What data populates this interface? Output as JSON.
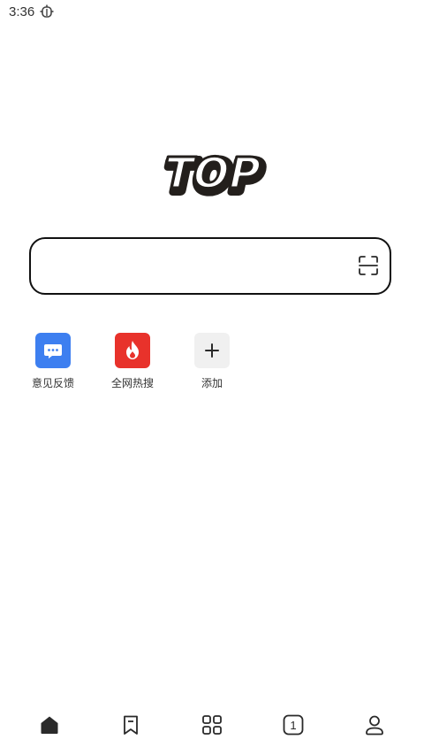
{
  "status_bar": {
    "time": "3:36",
    "notification_icon": "bug-icon"
  },
  "logo": {
    "text": "TOP",
    "colors": {
      "fill": "#ffffff",
      "outline": "#231f1c"
    }
  },
  "search": {
    "value": "",
    "placeholder": "",
    "scan_icon": "scan-icon"
  },
  "shortcuts": [
    {
      "label": "意见反馈",
      "icon": "chat-bubble-icon",
      "color": "#3d7ff0"
    },
    {
      "label": "全网热搜",
      "icon": "flame-icon",
      "color": "#e8322b"
    },
    {
      "label": "添加",
      "icon": "plus-icon",
      "color": "#f0f0f0"
    }
  ],
  "tab_bar": {
    "items": [
      {
        "icon": "home-icon",
        "active": true
      },
      {
        "icon": "bookmark-icon",
        "active": false
      },
      {
        "icon": "apps-grid-icon",
        "active": false
      },
      {
        "icon": "tabs-icon",
        "count": "1",
        "active": false
      },
      {
        "icon": "profile-icon",
        "active": false
      }
    ]
  },
  "colors": {
    "icon": "#2a2a2a",
    "text": "#333333",
    "border": "#111111"
  }
}
